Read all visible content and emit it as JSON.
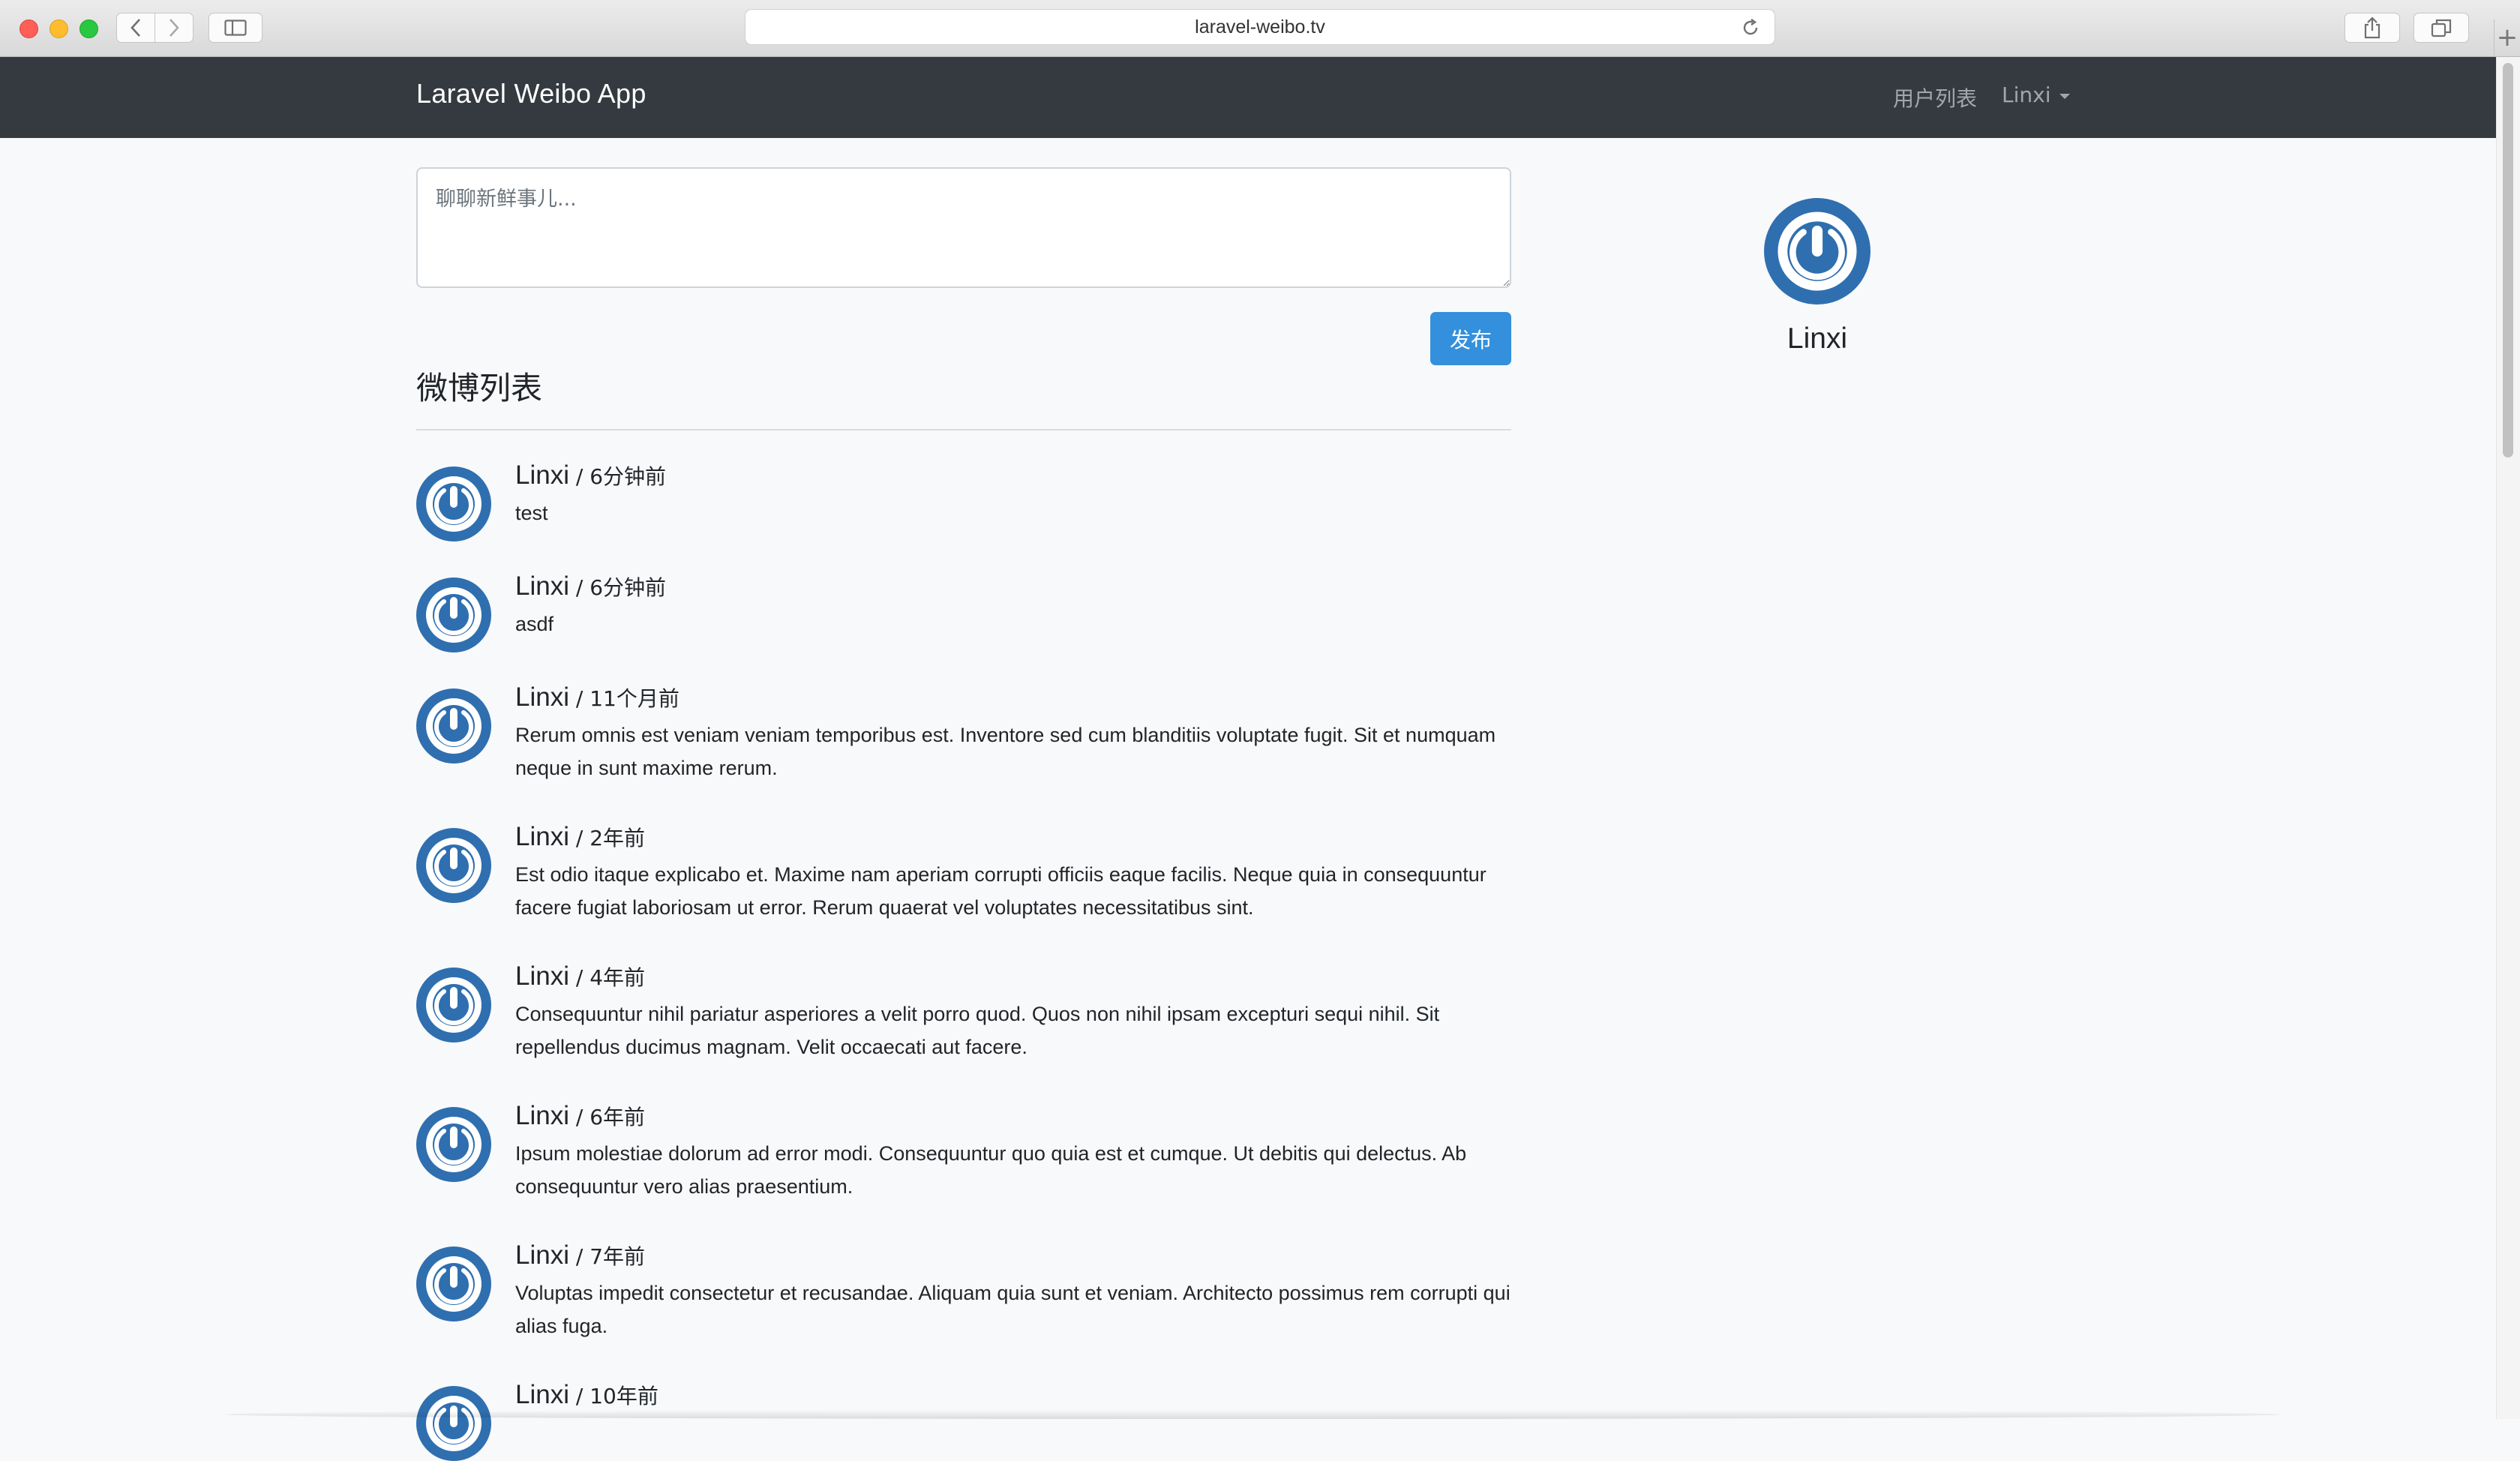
{
  "browser": {
    "url": "laravel-weibo.tv"
  },
  "navbar": {
    "brand": "Laravel Weibo App",
    "users_link": "用户列表",
    "user_menu": "Linxi"
  },
  "composer": {
    "placeholder": "聊聊新鲜事儿...",
    "submit_label": "发布"
  },
  "feed": {
    "title": "微博列表",
    "posts": [
      {
        "author": "Linxi",
        "time": " / 6分钟前",
        "content": "test"
      },
      {
        "author": "Linxi",
        "time": " / 6分钟前",
        "content": "asdf"
      },
      {
        "author": "Linxi",
        "time": " / 11个月前",
        "content": "Rerum omnis est veniam veniam temporibus est. Inventore sed cum blanditiis voluptate fugit. Sit et numquam neque in sunt maxime rerum."
      },
      {
        "author": "Linxi",
        "time": " / 2年前",
        "content": "Est odio itaque explicabo et. Maxime nam aperiam corrupti officiis eaque facilis. Neque quia in consequuntur facere fugiat laboriosam ut error. Rerum quaerat vel voluptates necessitatibus sint."
      },
      {
        "author": "Linxi",
        "time": " / 4年前",
        "content": "Consequuntur nihil pariatur asperiores a velit porro quod. Quos non nihil ipsam excepturi sequi nihil. Sit repellendus ducimus magnam. Velit occaecati aut facere."
      },
      {
        "author": "Linxi",
        "time": " / 6年前",
        "content": "Ipsum molestiae dolorum ad error modi. Consequuntur quo quia est et cumque. Ut debitis qui delectus. Ab consequuntur vero alias praesentium."
      },
      {
        "author": "Linxi",
        "time": " / 7年前",
        "content": "Voluptas impedit consectetur et recusandae. Aliquam quia sunt et veniam. Architecto possimus rem corrupti qui alias fuga."
      },
      {
        "author": "Linxi",
        "time": " / 10年前",
        "content": ""
      }
    ]
  },
  "sidebar": {
    "name": "Linxi"
  },
  "colors": {
    "navbar": "#343a40",
    "primary_button": "#3490dc",
    "avatar_blue": "#2f6fb0"
  }
}
